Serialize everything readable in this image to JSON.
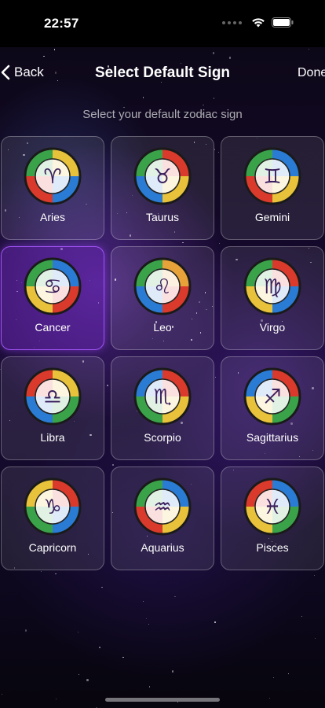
{
  "status_bar": {
    "time": "22:57",
    "icons": [
      "signal-dots-icon",
      "wifi-icon",
      "battery-icon"
    ]
  },
  "nav": {
    "back_label": "Back",
    "title": "Select Default Sign",
    "done_label": "Done"
  },
  "subtitle": "Select your default zodiac sign",
  "selected_sign": "Cancer",
  "colors": {
    "selected_border": "#aa5aff",
    "selected_bg": "#6e28be",
    "background": "#140a2a"
  },
  "signs": [
    {
      "label": "Aries",
      "glyph": "♈"
    },
    {
      "label": "Taurus",
      "glyph": "♉"
    },
    {
      "label": "Gemini",
      "glyph": "♊"
    },
    {
      "label": "Cancer",
      "glyph": "♋"
    },
    {
      "label": "Leo",
      "glyph": "♌"
    },
    {
      "label": "Virgo",
      "glyph": "♍"
    },
    {
      "label": "Libra",
      "glyph": "♎"
    },
    {
      "label": "Scorpio",
      "glyph": "♏"
    },
    {
      "label": "Sagittarius",
      "glyph": "♐"
    },
    {
      "label": "Capricorn",
      "glyph": "♑"
    },
    {
      "label": "Aquarius",
      "glyph": "♒"
    },
    {
      "label": "Pisces",
      "glyph": "♓"
    }
  ]
}
